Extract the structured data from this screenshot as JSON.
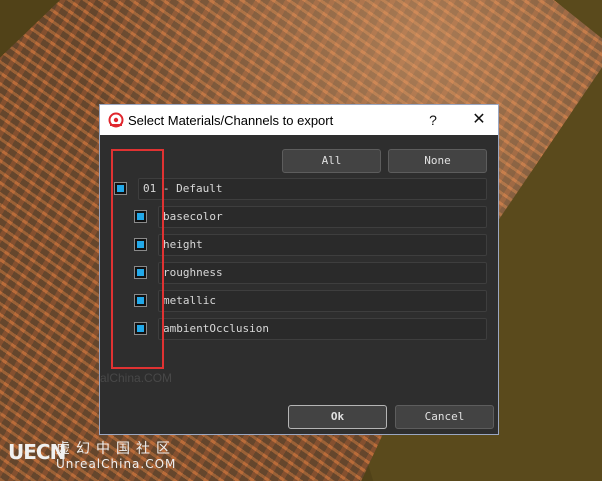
{
  "dialog": {
    "title": "Select Materials/Channels to export",
    "help_label": "?",
    "close_label": "✕",
    "all_label": "All",
    "none_label": "None",
    "ok_label": "Ok",
    "cancel_label": "Cancel"
  },
  "material": {
    "label": "01 - Default",
    "checked": true
  },
  "channels": [
    {
      "label": "basecolor",
      "checked": true
    },
    {
      "label": "height",
      "checked": true
    },
    {
      "label": "roughness",
      "checked": true
    },
    {
      "label": "metallic",
      "checked": true
    },
    {
      "label": "ambientOcclusion",
      "checked": true
    }
  ],
  "watermark": {
    "logo": "UECN",
    "chinese": "虚幻中国社区",
    "english": "UnrealChina.COM",
    "faint": "alChina.COM"
  },
  "colors": {
    "checkbox_fill": "#22a8e8",
    "highlight": "#e03232",
    "dialog_bg": "#2e2e2e"
  }
}
